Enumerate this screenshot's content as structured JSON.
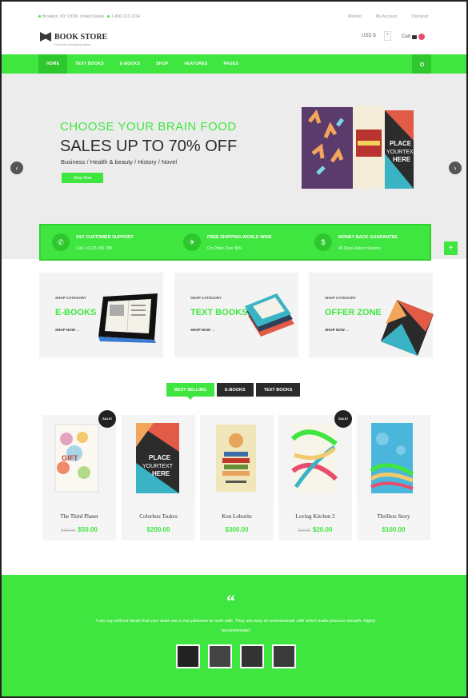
{
  "topbar": {
    "address": "Brooklyn, NY 10036, United States",
    "phone": "1-800-123-1234",
    "links": [
      "Wishlist",
      "My Account",
      "Checkout"
    ]
  },
  "brand": {
    "name": "BOOK STORE",
    "tagline": "Premium shopping theme"
  },
  "header": {
    "currency": "USD $",
    "cart_label": "Cart"
  },
  "nav": {
    "items": [
      "HOME",
      "TEXT BOOKS",
      "E-BOOKS",
      "SHOP",
      "FEATURES",
      "PAGES"
    ],
    "active": "HOME"
  },
  "hero": {
    "pretitle": "CHOOSE YOUR BRAIN FOOD",
    "title": "SALES UP TO 70% OFF",
    "subtitle": "Business / Health & beauty / History / Novel",
    "button": "Shop Now"
  },
  "features": [
    {
      "icon": "phone-icon",
      "title": "24/7 CUSTOMER SUPPORT",
      "sub": "Call + 0123 456 789"
    },
    {
      "icon": "plane-icon",
      "title": "FREE SHIPPING WORLD WIDE",
      "sub": "On Order Over $99"
    },
    {
      "icon": "dollar-icon",
      "title": "MONEY BACK GUARANTEE",
      "sub": "45 Days Return Service"
    }
  ],
  "categories": [
    {
      "kicker": "SHOP CATEGORY",
      "title": "E-BOOKS",
      "cta": "SHOP NOW →"
    },
    {
      "kicker": "SHOP CATEGORY",
      "title": "TEXT BOOKS",
      "cta": "SHOP NOW →"
    },
    {
      "kicker": "SHOP CATEGORY",
      "title": "OFFER ZONE",
      "cta": "SHOP NOW →"
    }
  ],
  "product_tabs": [
    "BEST SELLING",
    "E-BOOKS",
    "TEXT BOOKS"
  ],
  "products": [
    {
      "name": "The Third Planet",
      "old_price": "$100.00",
      "price": "$50.00",
      "sale": "SALE!"
    },
    {
      "name": "Colorless Tsukru",
      "old_price": "",
      "price": "$200.00",
      "sale": ""
    },
    {
      "name": "Kon Loborits",
      "old_price": "",
      "price": "$300.00",
      "sale": ""
    },
    {
      "name": "Loving Kitchen 2",
      "old_price": "$40.00",
      "price": "$20.00",
      "sale": "SALE!"
    },
    {
      "name": "Thrillers Story",
      "old_price": "",
      "price": "$100.00",
      "sale": ""
    }
  ],
  "testimonial": {
    "quote_mark": "“",
    "text": "I can say without doubt that your team are a true pleasure to work with. They are easy to communicate with which make process smooth. Highly recommended"
  },
  "colors": {
    "accent": "#3fe63f",
    "dark": "#2a2a2a"
  }
}
